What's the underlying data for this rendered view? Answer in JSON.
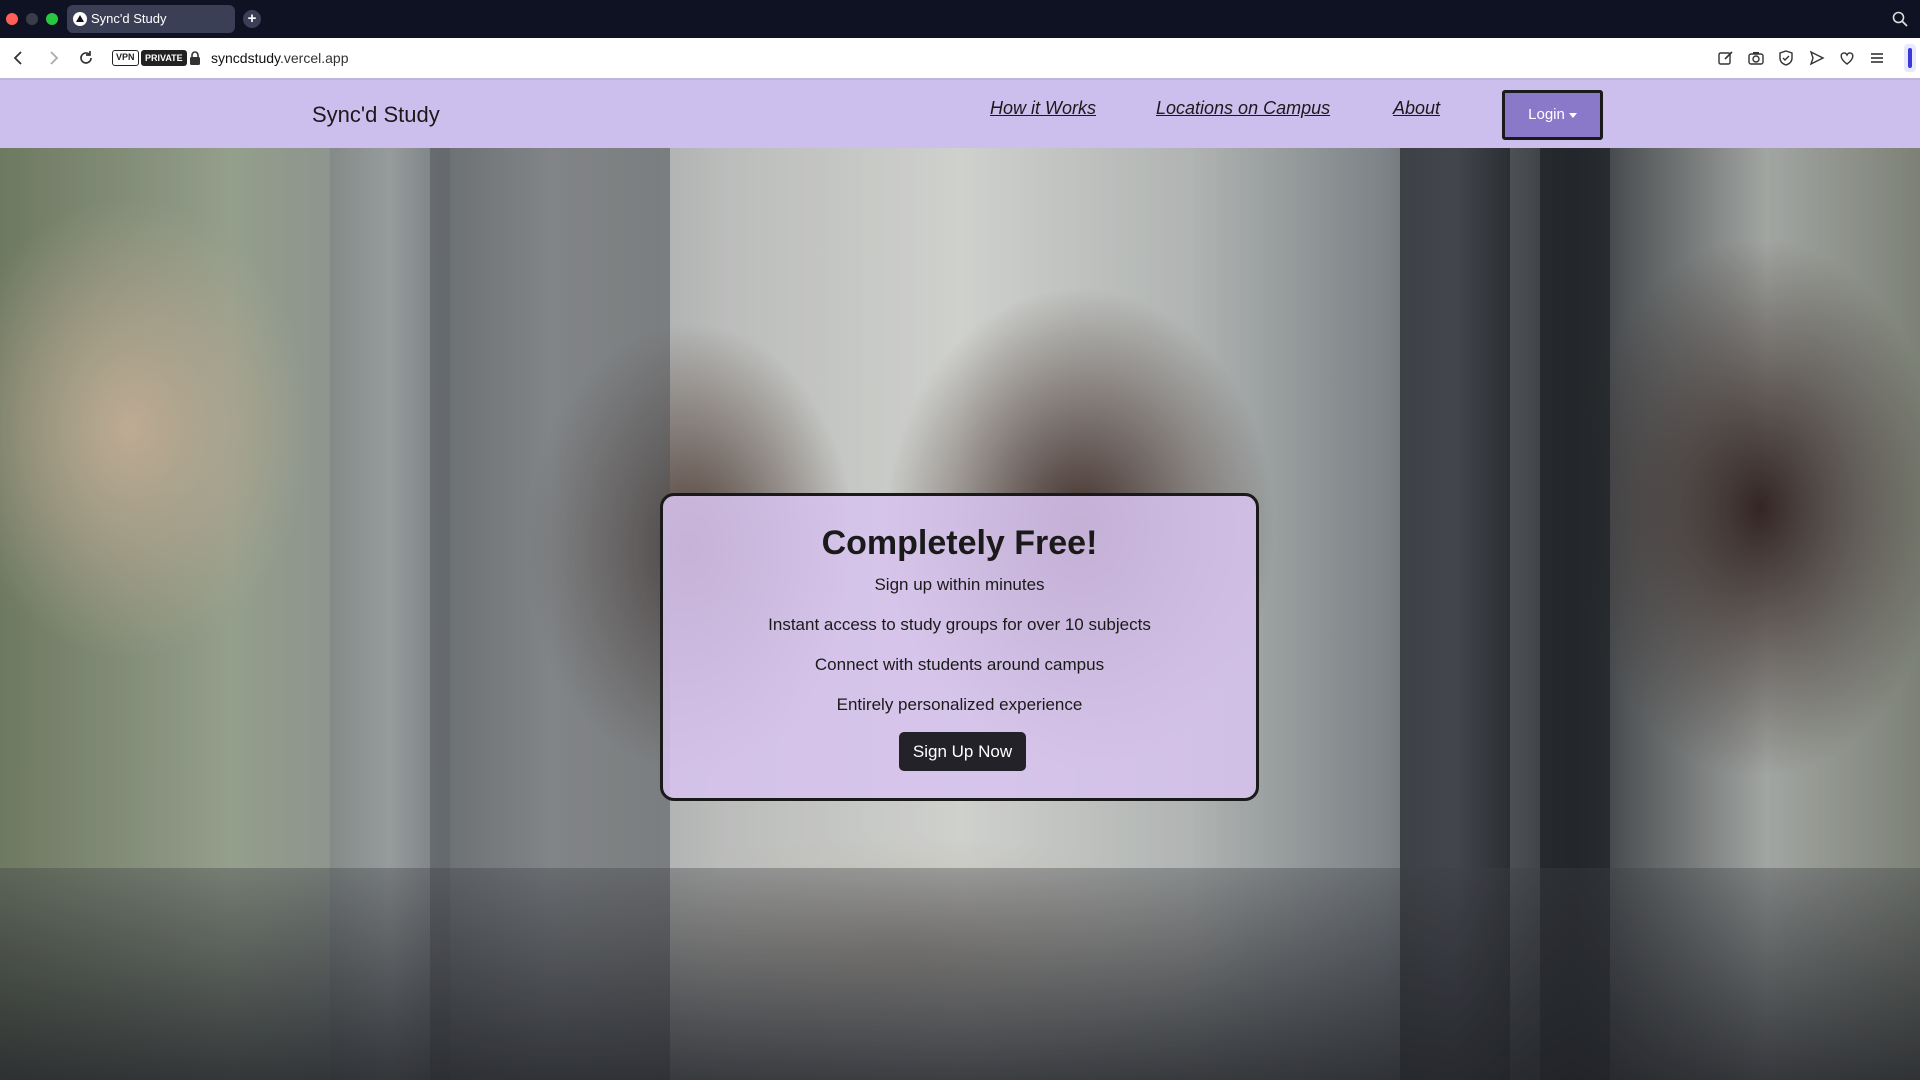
{
  "browser": {
    "tab_title": "Sync'd Study",
    "url_domain": "syncdstudy",
    "url_rest": ".vercel.app",
    "vpn_label": "VPN",
    "private_label": "PRIVATE"
  },
  "navbar": {
    "brand": "Sync'd Study",
    "links": [
      "How it Works",
      "Locations on Campus",
      "About"
    ],
    "login_label": "Login"
  },
  "hero": {
    "title": "Completely Free!",
    "lines": [
      "Sign up within minutes",
      "Instant access to study groups for over 10 subjects",
      "Connect with students around campus",
      "Entirely personalized experience"
    ],
    "cta_label": "Sign Up Now"
  },
  "colors": {
    "navbar_bg": "#cdbfed",
    "login_bg": "#8a78c9",
    "card_bg": "#d7c3ee",
    "cta_bg": "#222228"
  }
}
